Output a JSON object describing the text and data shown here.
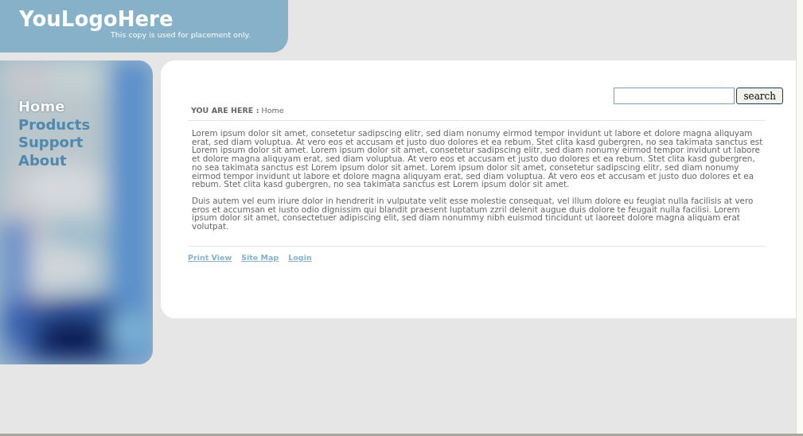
{
  "header": {
    "logo": "YouLogoHere",
    "tagline": "This copy is used for placement only."
  },
  "nav": [
    {
      "label": "Home",
      "selected": true
    },
    {
      "label": "Products",
      "selected": false
    },
    {
      "label": "Support",
      "selected": false
    },
    {
      "label": "About",
      "selected": false
    }
  ],
  "search": {
    "button": "search"
  },
  "breadcrumb": {
    "label": "YOU ARE HERE :",
    "current": "Home"
  },
  "paragraphs": [
    "Lorem ipsum dolor sit amet, consetetur sadipscing elitr,  sed diam nonumy eirmod tempor invidunt ut labore et dolore magna aliquyam erat, sed diam voluptua. At vero eos et accusam et justo duo dolores et ea rebum. Stet clita kasd gubergren, no sea takimata sanctus est Lorem ipsum dolor sit amet. Lorem ipsum dolor sit amet, consetetur sadipscing elitr,  sed diam nonumy eirmod tempor invidunt ut labore et dolore magna aliquyam erat, sed diam voluptua. At vero eos et accusam et justo duo dolores et ea rebum. Stet clita kasd gubergren, no sea takimata sanctus est Lorem ipsum dolor sit amet. Lorem ipsum dolor sit amet, consetetur sadipscing elitr,  sed diam nonumy eirmod tempor invidunt ut labore et dolore magna aliquyam erat, sed diam voluptua. At vero eos et accusam et justo duo dolores et ea rebum. Stet clita kasd gubergren, no sea takimata sanctus est Lorem ipsum dolor sit amet.",
    "Duis autem vel eum iriure dolor in hendrerit in vulputate velit esse molestie consequat, vel illum dolore eu feugiat nulla facilisis at vero eros et accumsan et iusto odio dignissim qui blandit praesent luptatum zzril delenit augue duis dolore te feugait nulla facilisi. Lorem ipsum dolor sit amet, consectetuer adipiscing elit, sed diam nonummy nibh euismod tincidunt ut laoreet dolore magna aliquam erat volutpat."
  ],
  "footer_links": [
    "Print View",
    "Site Map",
    "Login"
  ]
}
